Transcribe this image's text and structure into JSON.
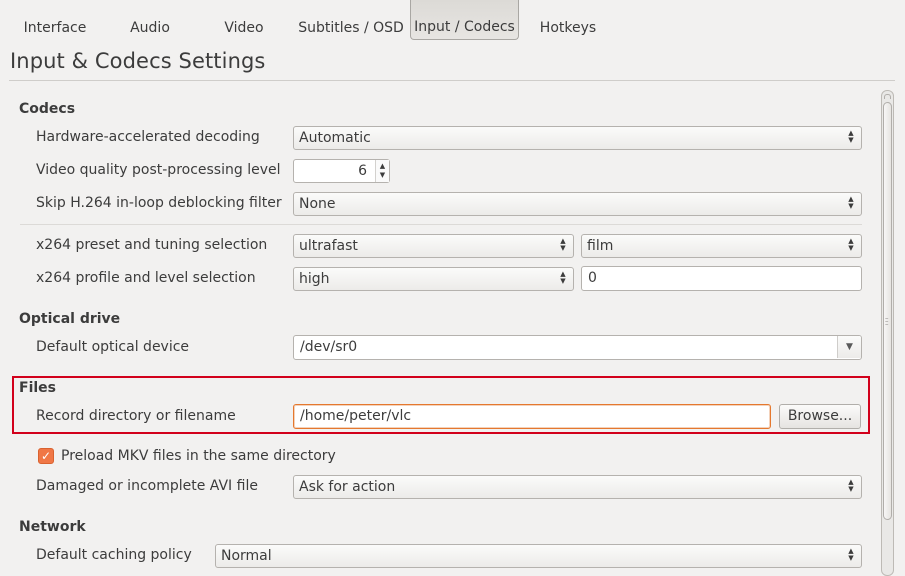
{
  "tabs": [
    {
      "label": "Interface",
      "icon": "interface-cone-icon",
      "active": false
    },
    {
      "label": "Audio",
      "icon": "audio-icon",
      "active": false
    },
    {
      "label": "Video",
      "icon": "video-icon",
      "active": false
    },
    {
      "label": "Subtitles / OSD",
      "icon": "subtitles-icon",
      "active": false
    },
    {
      "label": "Input / Codecs",
      "icon": "input-codecs-icon",
      "active": true
    },
    {
      "label": "Hotkeys",
      "icon": "hotkeys-icon",
      "active": false
    }
  ],
  "page_title": "Input & Codecs Settings",
  "colors": {
    "accent": "#f07746",
    "highlight": "#d2001b",
    "focus_border": "#e5782e"
  },
  "codecs": {
    "title": "Codecs",
    "hw_decoding": {
      "label": "Hardware-accelerated decoding",
      "value": "Automatic"
    },
    "postproc": {
      "label": "Video quality post-processing level",
      "value": "6"
    },
    "skip_h264": {
      "label": "Skip H.264 in-loop deblocking filter",
      "value": "None"
    },
    "x264_preset": {
      "label": "x264 preset and tuning selection",
      "preset": "ultrafast",
      "tuning": "film"
    },
    "x264_profile": {
      "label": "x264 profile and level selection",
      "profile": "high",
      "level": "0"
    }
  },
  "optical": {
    "title": "Optical drive",
    "device": {
      "label": "Default optical device",
      "value": "/dev/sr0"
    }
  },
  "files": {
    "title": "Files",
    "record": {
      "label": "Record directory or filename",
      "value": "/home/peter/vlc",
      "browse": "Browse..."
    },
    "preload_mkv": {
      "label": "Preload MKV files in the same directory",
      "checked": true
    },
    "damaged_avi": {
      "label": "Damaged or incomplete AVI file",
      "value": "Ask for action"
    }
  },
  "network": {
    "title": "Network",
    "caching": {
      "label": "Default caching policy",
      "value": "Normal"
    }
  }
}
